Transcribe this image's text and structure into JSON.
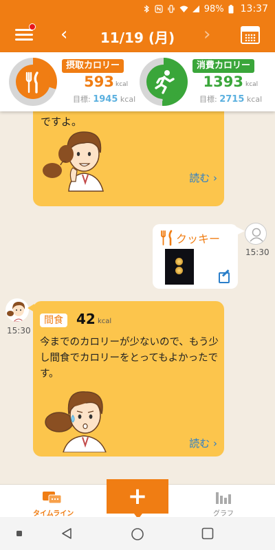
{
  "status_bar": {
    "battery": "98%",
    "time": "13:37"
  },
  "header": {
    "date": "11/19 (月)",
    "prev_arrow": "‹",
    "next_arrow": "›"
  },
  "summary": {
    "intake": {
      "label": "摂取カロリー",
      "value": "593",
      "unit": "kcal",
      "goal_label": "目標:",
      "goal": "1945",
      "goal_unit": "kcal",
      "progress": 0.3
    },
    "burn": {
      "label": "消費カロリー",
      "value": "1393",
      "unit": "kcal",
      "goal_label": "目標:",
      "goal": "2715",
      "goal_unit": "kcal",
      "progress": 0.51
    }
  },
  "timeline": {
    "advice_1": {
      "text": "ですよ。",
      "read_more": "読む ›"
    },
    "user_entry": {
      "food": "クッキー",
      "time": "15:30"
    },
    "advice_2": {
      "time": "15:30",
      "category": "間食",
      "kcal": "42",
      "unit": "kcal",
      "text": "今までのカロリーが少ないので、もう少し間食でカロリーをとってもよかったです。",
      "read_more": "読む ›"
    }
  },
  "bottom_nav": {
    "timeline_label": "タイムライン",
    "add_label": "+",
    "graph_label": "グラフ"
  },
  "colors": {
    "accent": "#f07d13",
    "burn": "#3aa63a",
    "bubble": "#fcc54c",
    "link": "#2a7ec9"
  }
}
